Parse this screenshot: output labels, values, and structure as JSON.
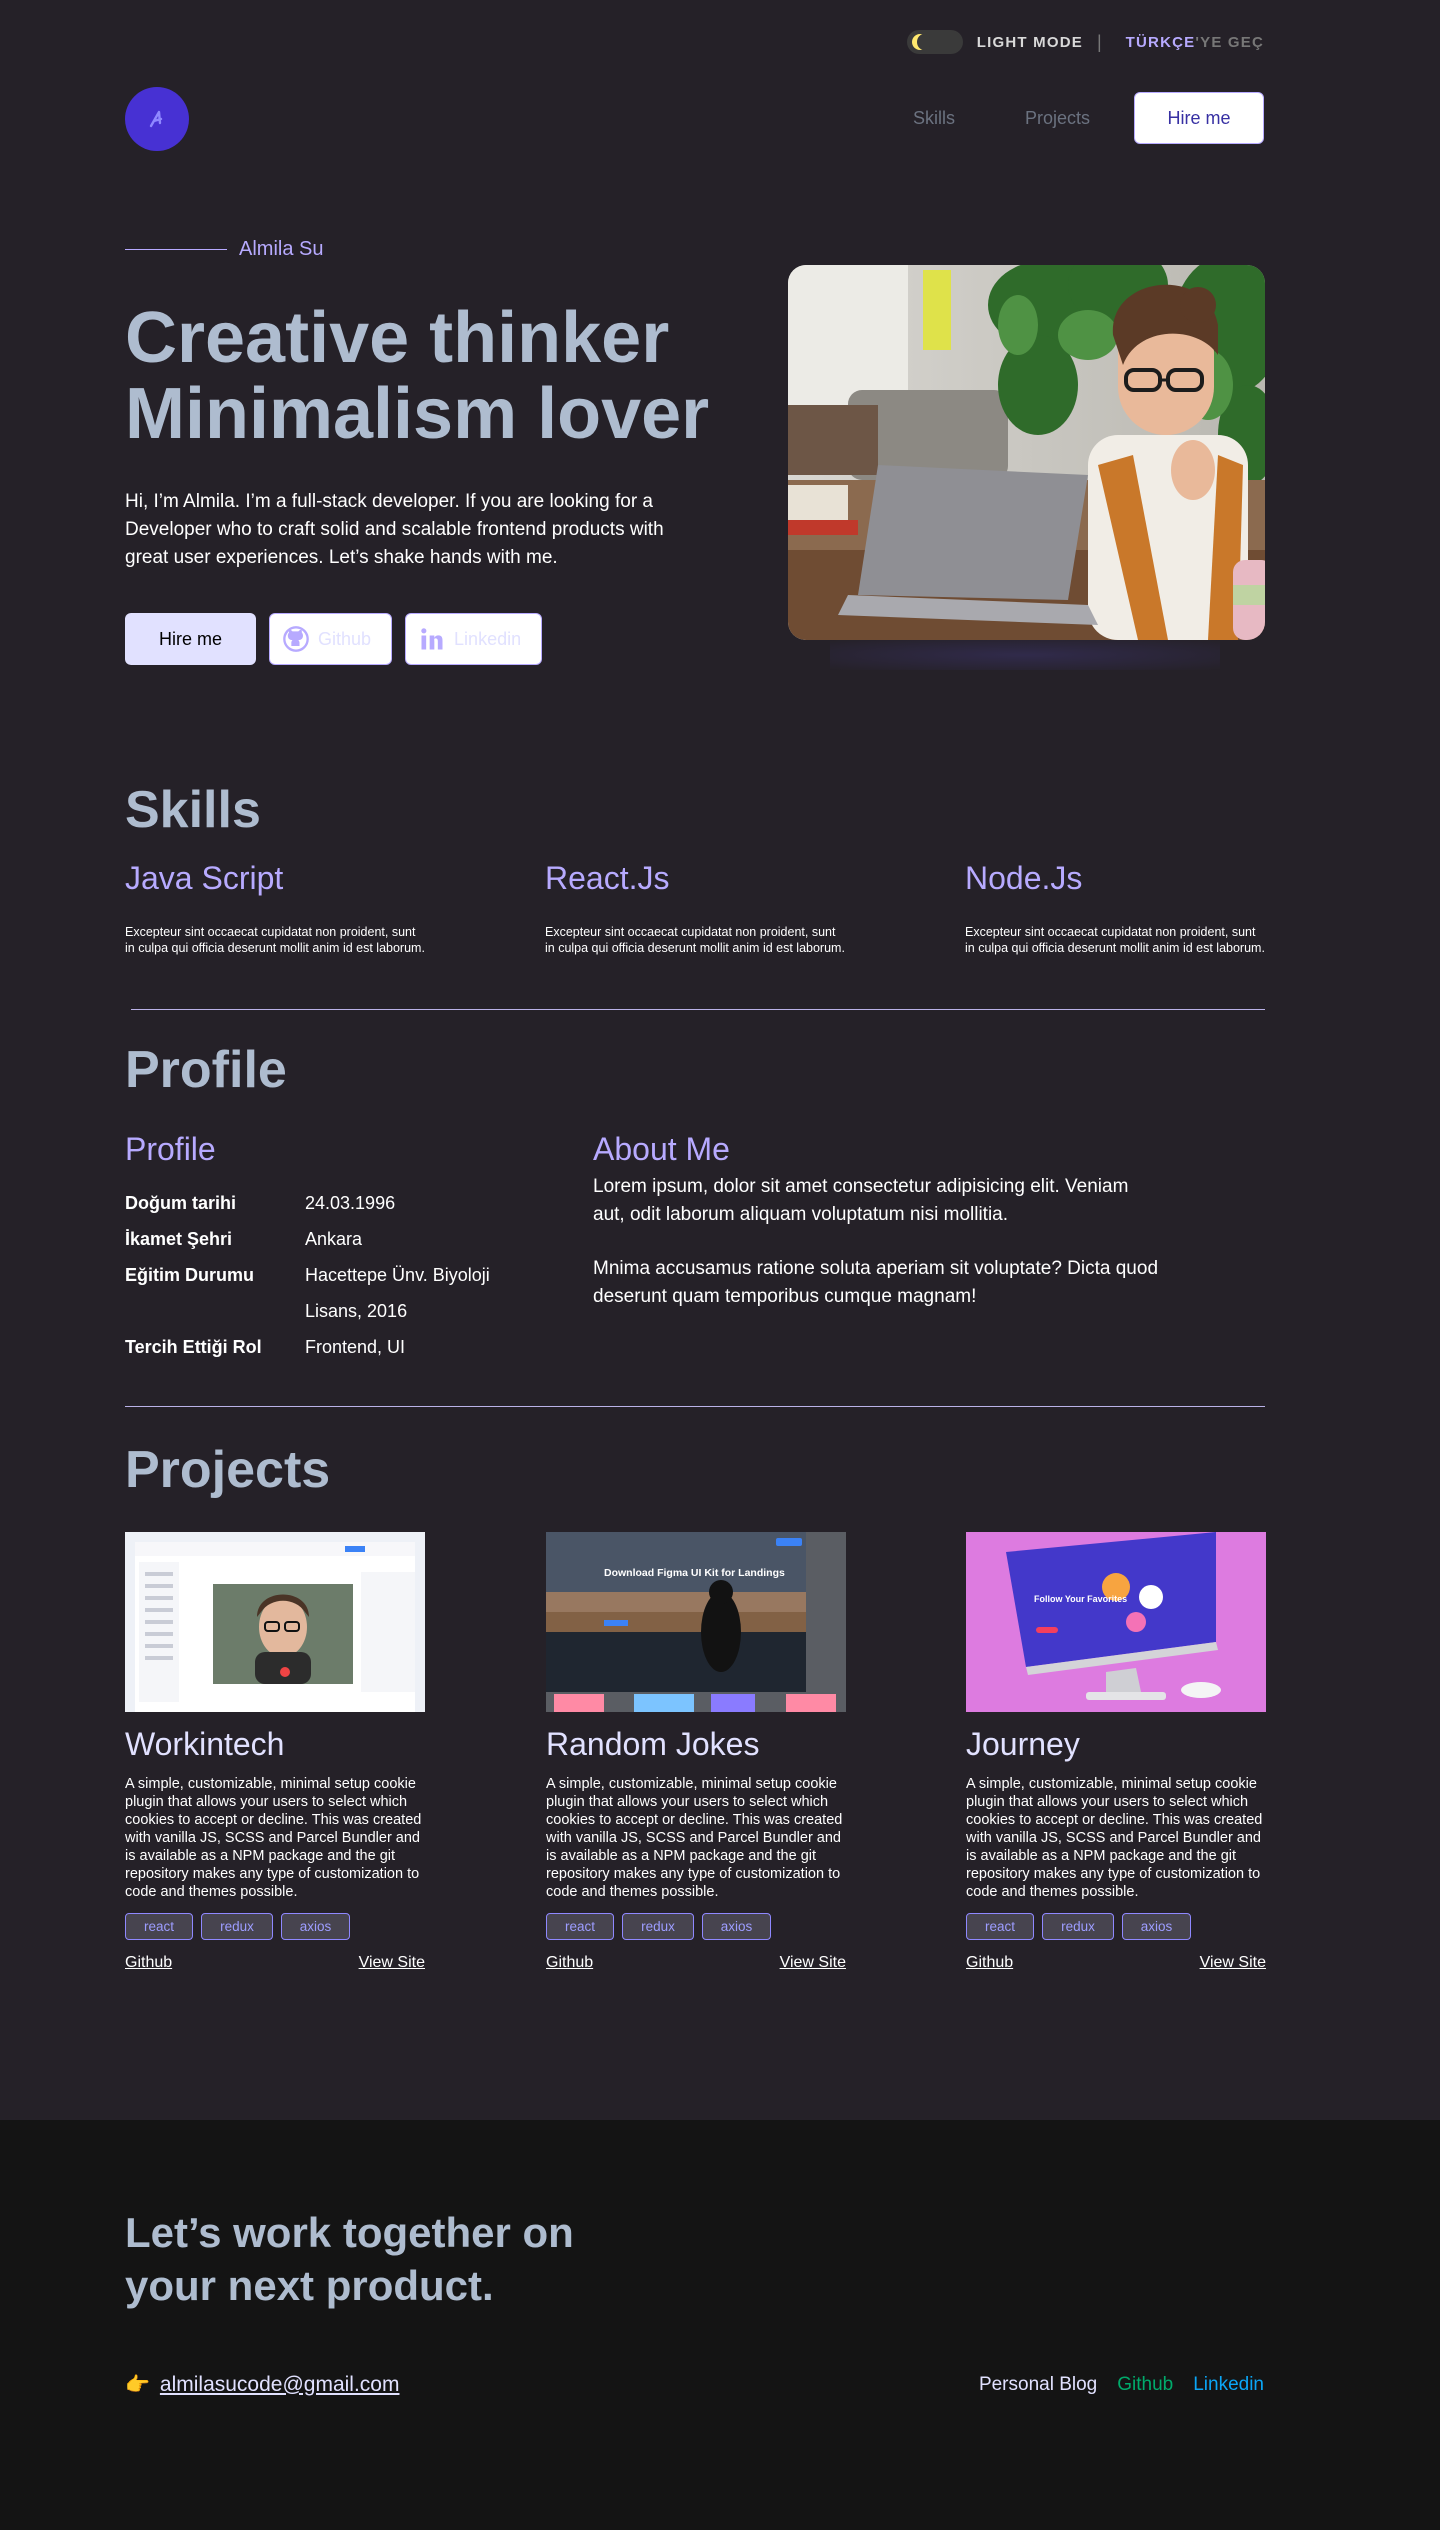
{
  "topbar": {
    "mode_label": "LIGHT MODE",
    "separator": "|",
    "lang_highlight": "TÜRKÇE",
    "lang_rest": "'YE GEÇ"
  },
  "nav": {
    "skills": "Skills",
    "projects": "Projects",
    "hire": "Hire me"
  },
  "hero": {
    "name": "Almila Su",
    "title_line1": "Creative thinker",
    "title_line2": "Minimalism lover",
    "description": "Hi, I’m Almila. I’m a full-stack developer. If you are looking for a Developer who to craft solid and scalable frontend products with great user experiences. Let’s shake hands with me.",
    "hire_btn": "Hire me",
    "github_btn": "Github",
    "linkedin_btn": "Linkedin"
  },
  "skills": {
    "title": "Skills",
    "items": [
      {
        "name": "Java Script",
        "desc": "Excepteur sint occaecat cupidatat non proident, sunt in culpa qui officia deserunt mollit anim id est laborum."
      },
      {
        "name": "React.Js",
        "desc": "Excepteur sint occaecat cupidatat non proident, sunt in culpa qui officia deserunt mollit anim id est laborum."
      },
      {
        "name": "Node.Js",
        "desc": "Excepteur sint occaecat cupidatat non proident, sunt in culpa qui officia deserunt mollit anim id est laborum."
      }
    ]
  },
  "profile": {
    "title": "Profile",
    "subtitle": "Profile",
    "rows": [
      {
        "k": "Doğum tarihi",
        "v": "24.03.1996"
      },
      {
        "k": "İkamet Şehri",
        "v": "Ankara"
      },
      {
        "k": "Eğitim Durumu",
        "v": "Hacettepe Ünv.  Biyoloji Lisans, 2016"
      },
      {
        "k": "Tercih Ettiği Rol",
        "v": "Frontend, UI"
      }
    ],
    "about_title": "About Me",
    "about_p1": "Lorem ipsum, dolor sit amet consectetur adipisicing elit. Veniam aut, odit laborum aliquam voluptatum nisi mollitia.",
    "about_p2": "Mnima accusamus ratione soluta aperiam sit voluptate? Dicta quod deserunt quam temporibus cumque magnam!"
  },
  "projects": {
    "title": "Projects",
    "items": [
      {
        "name": "Workintech",
        "desc": "A simple, customizable, minimal setup cookie plugin that allows your users to select which cookies to accept or decline. This was created with vanilla JS, SCSS and Parcel Bundler and is available as a NPM package and the git repository makes any type of customization to code and themes possible.",
        "tags": [
          "react",
          "redux",
          "axios"
        ],
        "github": "Github",
        "site": "View Site"
      },
      {
        "name": "Random Jokes",
        "desc": "A simple, customizable, minimal setup cookie plugin that allows your users to select which cookies to accept or decline. This was created with vanilla JS, SCSS and Parcel Bundler and is available as a NPM package and the git repository makes any type of customization to code and themes possible.",
        "tags": [
          "react",
          "redux",
          "axios"
        ],
        "github": "Github",
        "site": "View Site",
        "thumb_text": "Download Figma UI Kit for Landings"
      },
      {
        "name": "Journey",
        "desc": "A simple, customizable, minimal setup cookie plugin that allows your users to select which cookies to accept or decline. This was created with vanilla JS, SCSS and Parcel Bundler and is available as a NPM package and the git repository makes any type of customization to code and themes possible.",
        "tags": [
          "react",
          "redux",
          "axios"
        ],
        "github": "Github",
        "site": "View Site",
        "thumb_text": "Follow Your Favorites"
      }
    ]
  },
  "footer": {
    "title_line1": "Let’s work together on",
    "title_line2": "your next product.",
    "hand_icon": "👉",
    "email": "almilasucode@gmail.com",
    "blog": "Personal Blog",
    "github": "Github",
    "linkedin": "Linkedin"
  },
  "colors": {
    "accent": "#B7AAFF",
    "heading": "#AEBCCF",
    "bg": "#252128",
    "footer_bg": "#141414",
    "github_link": "#00AB6B",
    "linkedin_link": "#0BA6F6"
  }
}
